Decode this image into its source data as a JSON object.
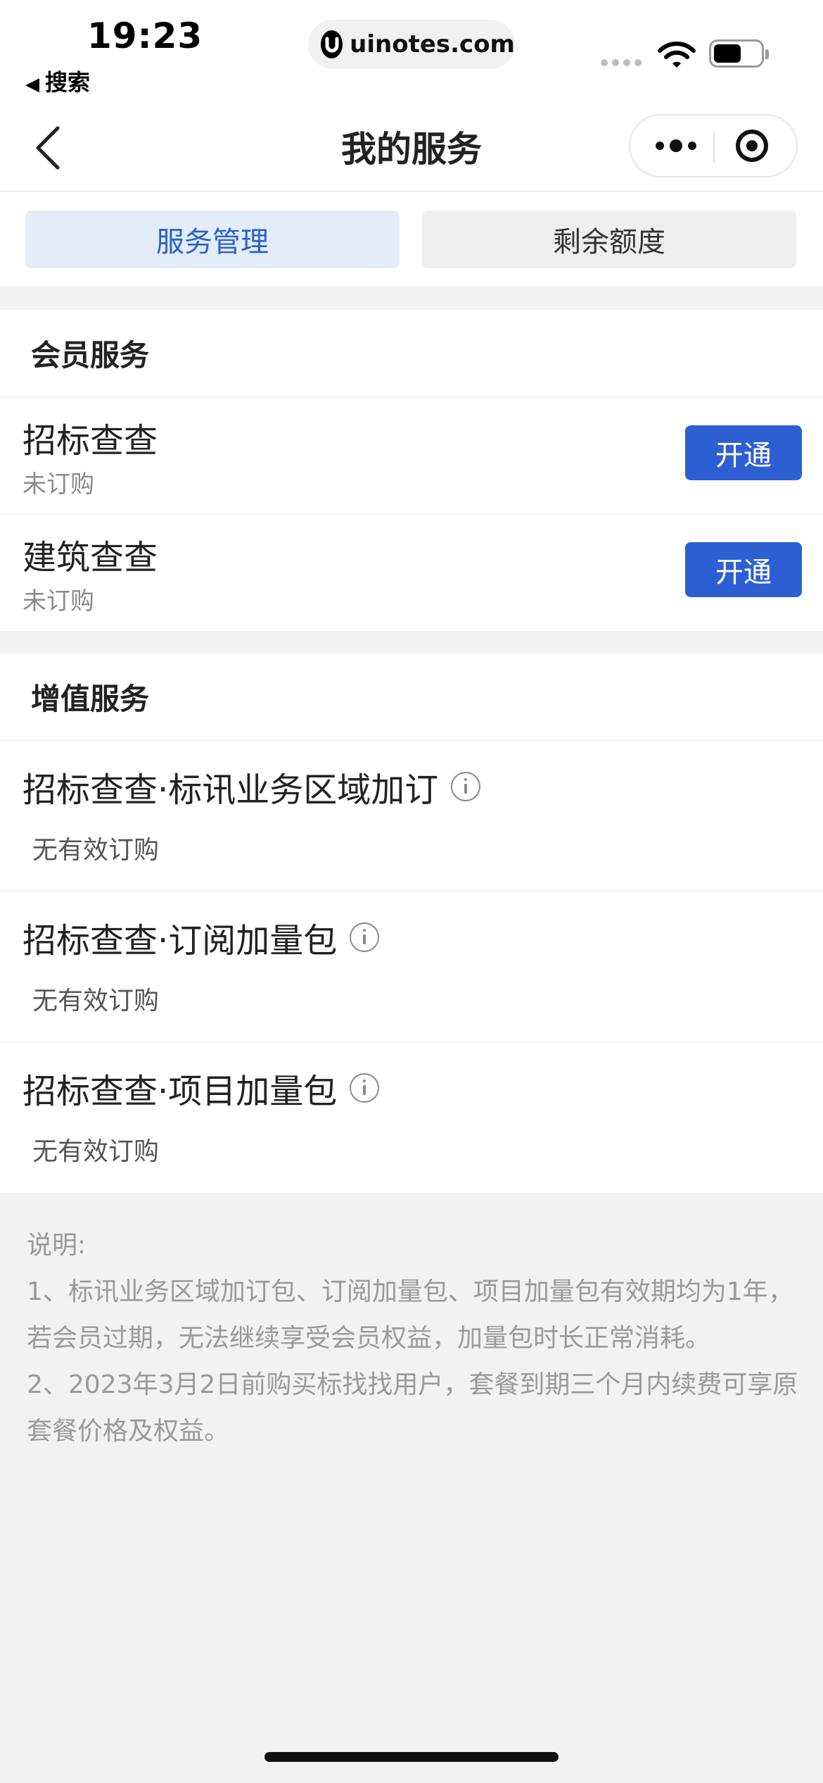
{
  "status_bar": {
    "time": "19:23",
    "back_app": "搜索",
    "url": "uinotes.com"
  },
  "nav": {
    "title": "我的服务",
    "back_icon": "chevron-left-icon",
    "more_icon": "more-dots-icon",
    "close_icon": "target-circle-icon"
  },
  "tabs": [
    {
      "label": "服务管理",
      "active": true
    },
    {
      "label": "剩余额度",
      "active": false
    }
  ],
  "member_services": {
    "heading": "会员服务",
    "items": [
      {
        "name": "招标查查",
        "status": "未订购",
        "button": "开通"
      },
      {
        "name": "建筑查查",
        "status": "未订购",
        "button": "开通"
      }
    ]
  },
  "value_added_services": {
    "heading": "增值服务",
    "items": [
      {
        "name": "招标查查·标讯业务区域加订",
        "status": "无有效订购"
      },
      {
        "name": "招标查查·订阅加量包",
        "status": "无有效订购"
      },
      {
        "name": "招标查查·项目加量包",
        "status": "无有效订购"
      }
    ]
  },
  "notes": {
    "title": "说明:",
    "line1": "1、标讯业务区域加订包、订阅加量包、项目加量包有效期均为1年，若会员过期，无法继续享受会员权益，加量包时长正常消耗。",
    "line2": "2、2023年3月2日前购买标找找用户，套餐到期三个月内续费可享原套餐价格及权益。"
  },
  "colors": {
    "accent": "#2d5fd2",
    "tab_active_bg": "#e3ecf9",
    "page_bg": "#f2f2f2"
  }
}
